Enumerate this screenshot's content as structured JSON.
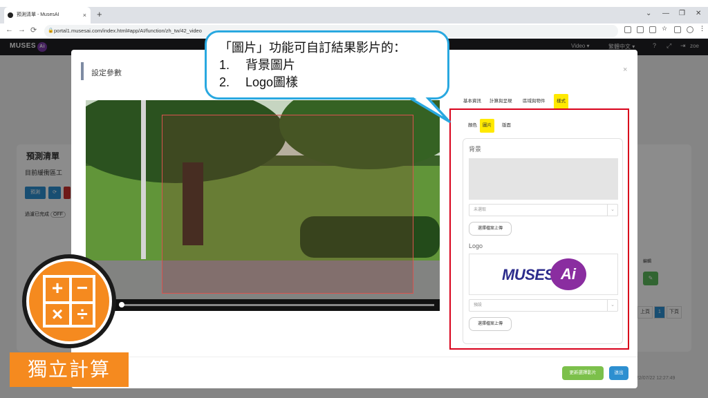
{
  "browser": {
    "tab_title": "預測清單 - MusesAI",
    "tab_close": "×",
    "new_tab": "+",
    "url": "portal1.musesai.com/index.html#app/AI/function/zh_tw/42_video",
    "win_minimize": "—",
    "win_restore": "❐",
    "win_close": "✕",
    "win_menu": "⌄"
  },
  "app": {
    "logo": "MUSES",
    "logo_badge": "Ai",
    "nav_video": "Video ▾",
    "nav_lang": "繁體中文 ▾",
    "nav_user": "zoe",
    "heading": "預測清單",
    "subtitle": "目前緩衝區工",
    "btn_predict": "預測",
    "btn_refresh": "⟳",
    "done_text": "過濾已完成",
    "done_toggle": "OFF",
    "col_edit": "編輯",
    "pager_prev": "上頁",
    "pager_page": "1",
    "pager_next": "下頁",
    "timestamp": "22/07/22 12:27:49",
    "accent": "#1f1f24"
  },
  "modal": {
    "title": "設定參數",
    "close": "×",
    "tabs": [
      "基本資訊",
      "計算與呈現",
      "區域與物件",
      "樣式"
    ],
    "active_tab_index": 3,
    "subtabs": [
      "顏色",
      "圖片",
      "版面"
    ],
    "active_subtab_index": 1,
    "background_label": "背景",
    "background_select": "未選取",
    "upload_label": "選擇檔案上傳",
    "logo_label": "Logo",
    "logo_select": "預設",
    "logo_word": "MUSES",
    "logo_ai": "Ai",
    "update_button": "更新選擇影片",
    "exit_button": "送出",
    "highlight_color": "#ffe900",
    "roi_color": "#d9534f"
  },
  "callout": {
    "line1": "「圖片」功能可自訂結果影片的：",
    "item1_num": "1.",
    "item1": "背景圖片",
    "item2_num": "2.",
    "item2": "Logo圖樣",
    "border_color": "#29a8e0"
  },
  "badge": {
    "calc_plus": "+",
    "calc_minus": "−",
    "calc_times": "×",
    "calc_divide": "÷",
    "label": "獨立計算",
    "color": "#f58a1f"
  }
}
